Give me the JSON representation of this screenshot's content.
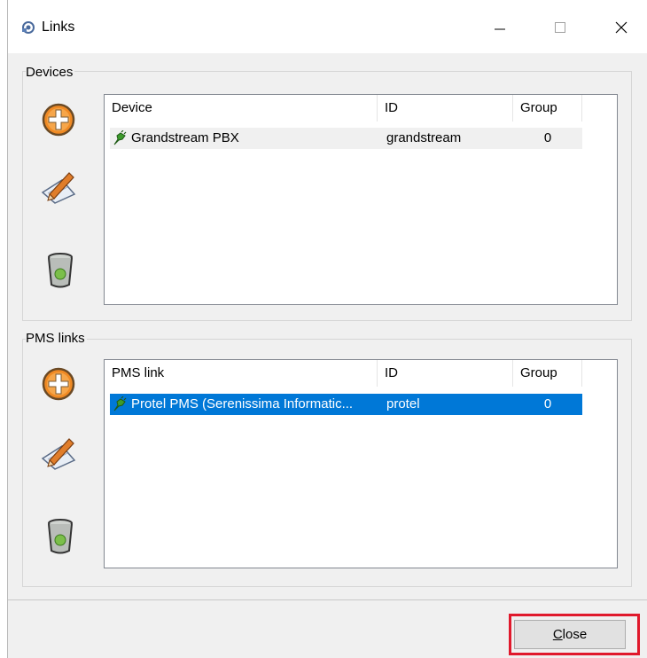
{
  "window": {
    "title": "Links"
  },
  "title_controls": {
    "minimize": "–",
    "maximize": "□",
    "close": "✕"
  },
  "devices": {
    "label": "Devices",
    "columns": [
      "Device",
      "ID",
      "Group"
    ],
    "rows": [
      {
        "name": "Grandstream PBX",
        "id": "grandstream",
        "group": "0",
        "selected": false
      }
    ]
  },
  "pms_links": {
    "label": "PMS links",
    "columns": [
      "PMS link",
      "ID",
      "Group"
    ],
    "rows": [
      {
        "name": "Protel PMS (Serenissima Informatic...",
        "id": "protel",
        "group": "0",
        "selected": true
      }
    ]
  },
  "footer": {
    "close_label": "Close",
    "close_accel": "C",
    "close_rest": "lose"
  },
  "colors": {
    "selection": "#0078d7",
    "highlight": "#e0192c"
  },
  "icons": [
    "links-app-icon",
    "add-icon",
    "edit-icon",
    "trash-icon",
    "connector-icon"
  ]
}
